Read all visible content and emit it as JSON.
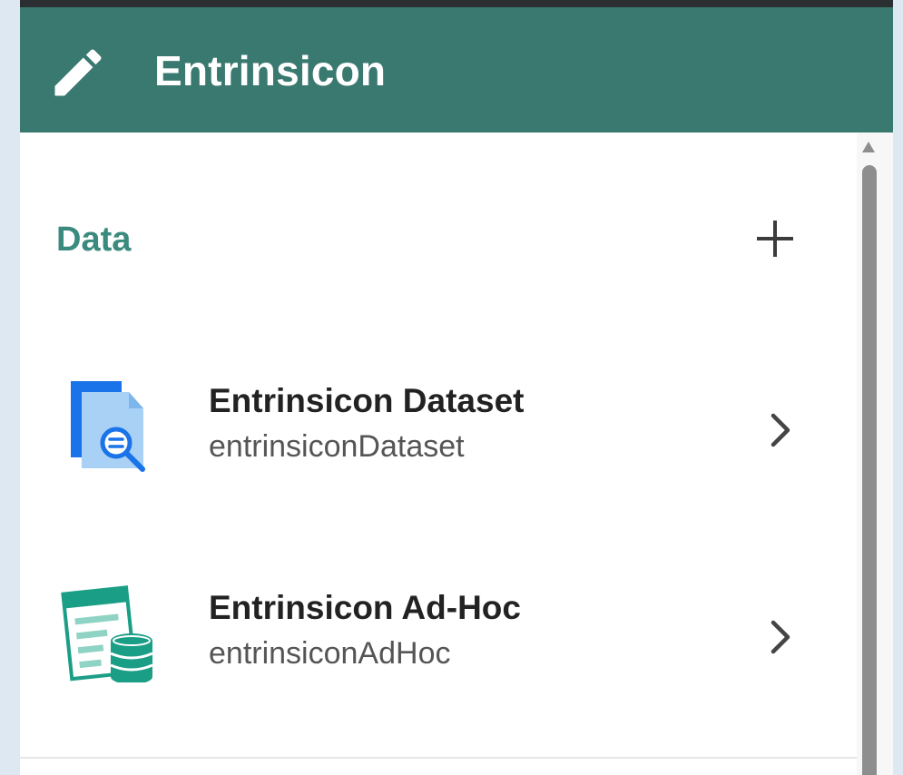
{
  "header": {
    "title": "Entrinsicon",
    "icon": "pencil-icon"
  },
  "section": {
    "title": "Data",
    "add_icon": "plus-icon"
  },
  "items": [
    {
      "title": "Entrinsicon Dataset",
      "subtitle": "entrinsiconDataset",
      "icon": "dataset-search-icon"
    },
    {
      "title": "Entrinsicon Ad-Hoc",
      "subtitle": "entrinsiconAdHoc",
      "icon": "adhoc-database-icon"
    }
  ],
  "colors": {
    "header_bg": "#3a7970",
    "section_title": "#3a8a7e",
    "page_bg": "#dde8f3"
  }
}
